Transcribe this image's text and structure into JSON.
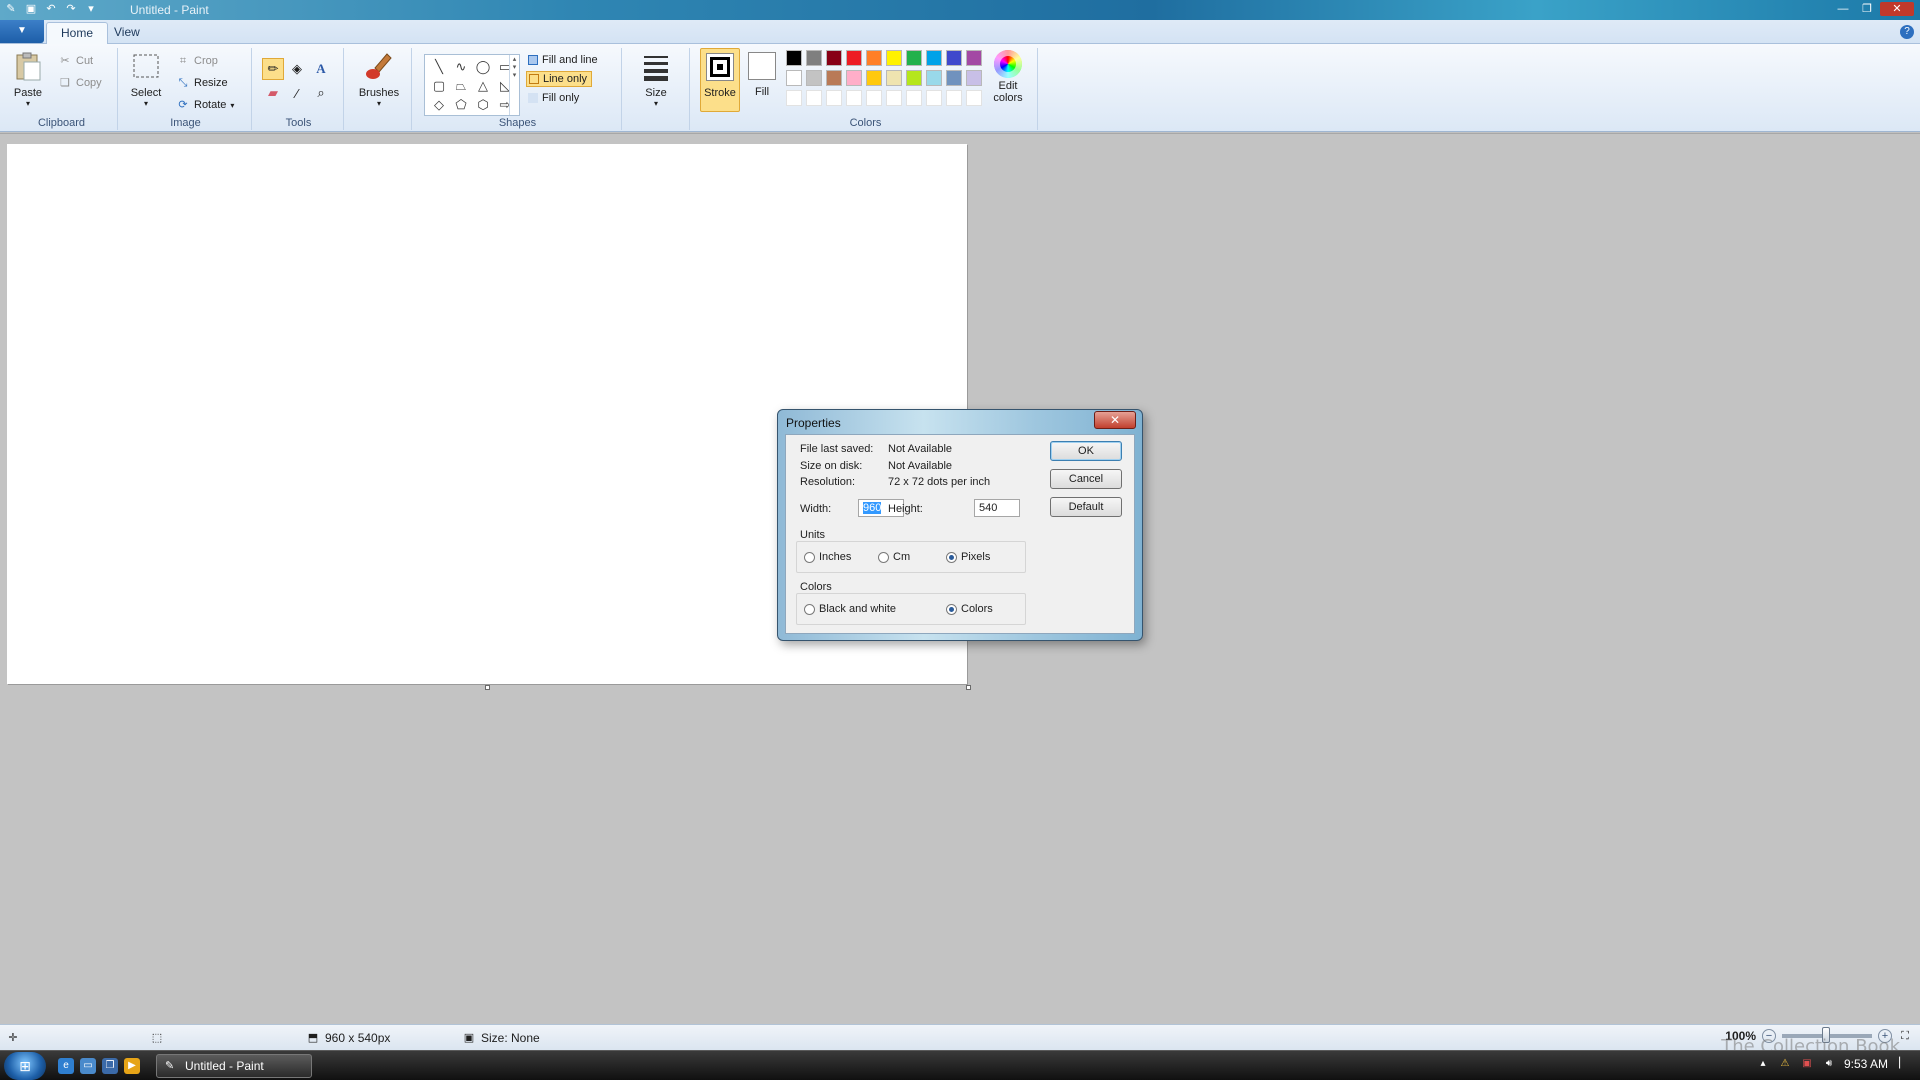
{
  "window": {
    "title": "Untitled - Paint"
  },
  "tabs": [
    {
      "label": "Home"
    },
    {
      "label": "View"
    }
  ],
  "clipboard": {
    "label": "Clipboard",
    "paste": "Paste",
    "cut": "Cut",
    "copy": "Copy"
  },
  "image": {
    "label": "Image",
    "select": "Select",
    "crop": "Crop",
    "resize": "Resize",
    "rotate": "Rotate"
  },
  "tools": {
    "label": "Tools"
  },
  "brushes": {
    "label": "Brushes"
  },
  "shapes": {
    "label": "Shapes",
    "fill_and_line": "Fill and line",
    "line_only": "Line only",
    "fill_only": "Fill only"
  },
  "size": {
    "label": "Size"
  },
  "colors": {
    "label": "Colors",
    "stroke": "Stroke",
    "fill": "Fill",
    "edit": "Edit colors",
    "palette": [
      "#000000",
      "#7f7f7f",
      "#880015",
      "#ed1c24",
      "#ff7f27",
      "#fff200",
      "#22b14c",
      "#00a2e8",
      "#3f48cc",
      "#a349a4",
      "#ffffff",
      "#c3c3c3",
      "#b97a57",
      "#ffaec9",
      "#ffc90e",
      "#efe4b0",
      "#b5e61d",
      "#99d9ea",
      "#7092be",
      "#c8bfe7",
      "#ffffff",
      "#ffffff",
      "#ffffff",
      "#ffffff",
      "#ffffff",
      "#ffffff",
      "#ffffff",
      "#ffffff",
      "#ffffff",
      "#ffffff"
    ]
  },
  "dialog": {
    "title": "Properties",
    "file_last_saved_label": "File last saved:",
    "file_last_saved_value": "Not Available",
    "size_on_disk_label": "Size on disk:",
    "size_on_disk_value": "Not Available",
    "resolution_label": "Resolution:",
    "resolution_value": "72 x 72 dots per inch",
    "width_label": "Width:",
    "width_value": "960",
    "height_label": "Height:",
    "height_value": "540",
    "units_label": "Units",
    "units_inches": "Inches",
    "units_cm": "Cm",
    "units_pixels": "Pixels",
    "colors_label": "Colors",
    "colors_bw": "Black and white",
    "colors_colors": "Colors",
    "ok": "OK",
    "cancel": "Cancel",
    "default": "Default"
  },
  "statusbar": {
    "dimensions": "960 x 540px",
    "size": "Size: None",
    "zoom": "100%"
  },
  "taskbar": {
    "task": "Untitled - Paint",
    "time": "9:53 AM"
  },
  "watermark": "The Collection Book"
}
